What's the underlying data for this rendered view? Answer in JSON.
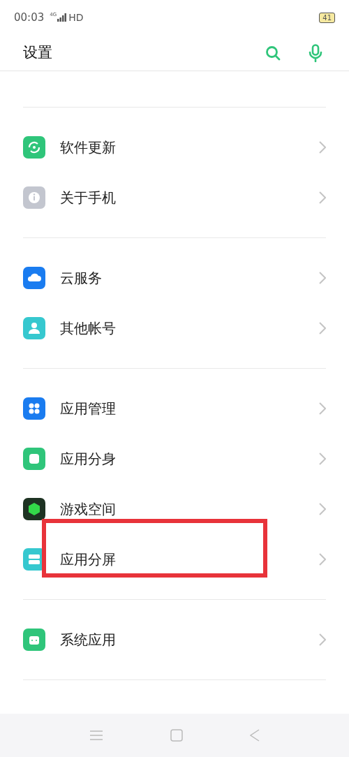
{
  "status_bar": {
    "time": "00:03",
    "network": "4G",
    "hd": "HD",
    "battery": "41"
  },
  "header": {
    "title": "设置"
  },
  "groups": [
    {
      "items": [
        {
          "label": "软件更新",
          "kind": "update",
          "color": "#2fc57a",
          "annotated": false
        },
        {
          "label": "关于手机",
          "kind": "info",
          "color": "#c3c6cf",
          "annotated": false
        }
      ]
    },
    {
      "items": [
        {
          "label": "云服务",
          "kind": "cloud",
          "color": "#1a7cf0",
          "annotated": false
        },
        {
          "label": "其他帐号",
          "kind": "person",
          "color": "#36c8cf",
          "annotated": false
        }
      ]
    },
    {
      "items": [
        {
          "label": "应用管理",
          "kind": "apps",
          "color": "#1a7cf0",
          "annotated": false
        },
        {
          "label": "应用分身",
          "kind": "clone",
          "color": "#2fc57a",
          "annotated": false
        },
        {
          "label": "游戏空间",
          "kind": "game",
          "color": "#1e3323",
          "annotated": false
        },
        {
          "label": "应用分屏",
          "kind": "split",
          "color": "#36c8cf",
          "annotated": true
        }
      ]
    },
    {
      "items": [
        {
          "label": "系统应用",
          "kind": "android",
          "color": "#2fc57a",
          "annotated": false
        }
      ]
    }
  ]
}
